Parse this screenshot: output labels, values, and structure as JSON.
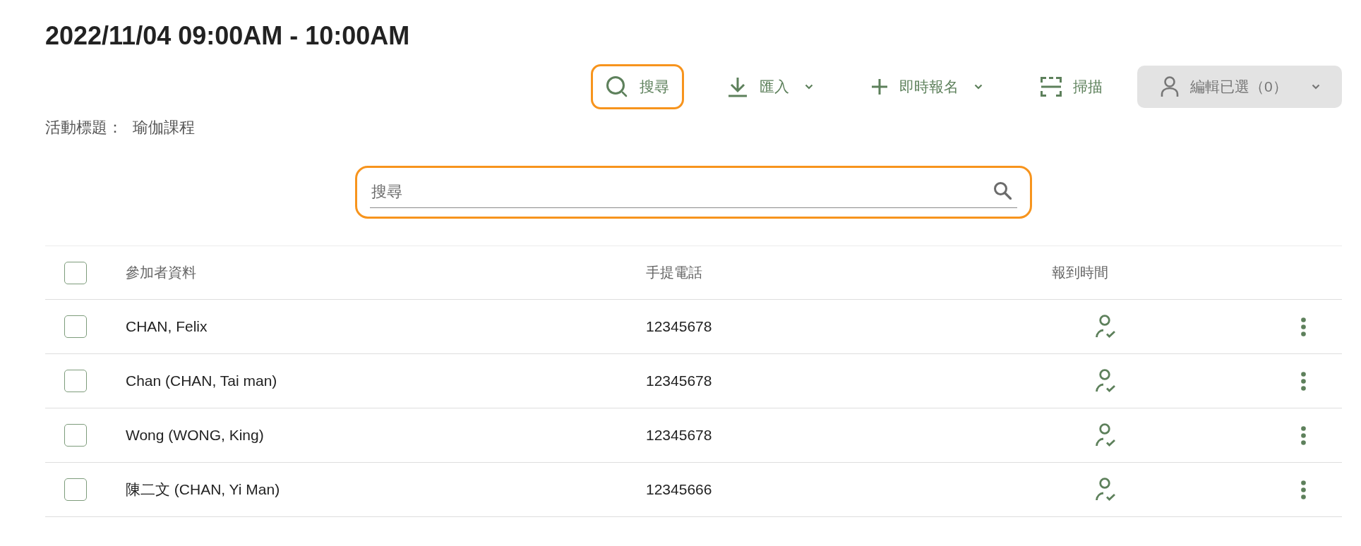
{
  "title": "2022/11/04 09:00AM - 10:00AM",
  "toolbar": {
    "buttons": [
      {
        "kind": "search",
        "label": "搜尋",
        "dropdown": false,
        "disabled": false,
        "highlighted": true
      },
      {
        "kind": "import",
        "label": "匯入",
        "dropdown": true,
        "disabled": false,
        "highlighted": false
      },
      {
        "kind": "register",
        "label": "即時報名",
        "dropdown": true,
        "disabled": false,
        "highlighted": false
      },
      {
        "kind": "scan",
        "label": "掃描",
        "dropdown": false,
        "disabled": false,
        "highlighted": false
      },
      {
        "kind": "edit",
        "label": "編輯已選（0）",
        "dropdown": true,
        "disabled": true,
        "highlighted": false
      }
    ]
  },
  "event": {
    "label": "活動標題：",
    "value": "瑜伽課程"
  },
  "search": {
    "placeholder": "搜尋",
    "highlighted": true
  },
  "table": {
    "select_all": {
      "checked": false
    },
    "columns": [
      "參加者資料",
      "手提電話",
      "報到時間"
    ],
    "rows": [
      {
        "checked": false,
        "name": "CHAN, Felix",
        "phone": "12345678"
      },
      {
        "checked": false,
        "name": "Chan (CHAN, Tai man)",
        "phone": "12345678"
      },
      {
        "checked": false,
        "name": "Wong (WONG, King)",
        "phone": "12345678"
      },
      {
        "checked": false,
        "name": "陳二文 (CHAN, Yi Man)",
        "phone": "12345666"
      }
    ]
  }
}
